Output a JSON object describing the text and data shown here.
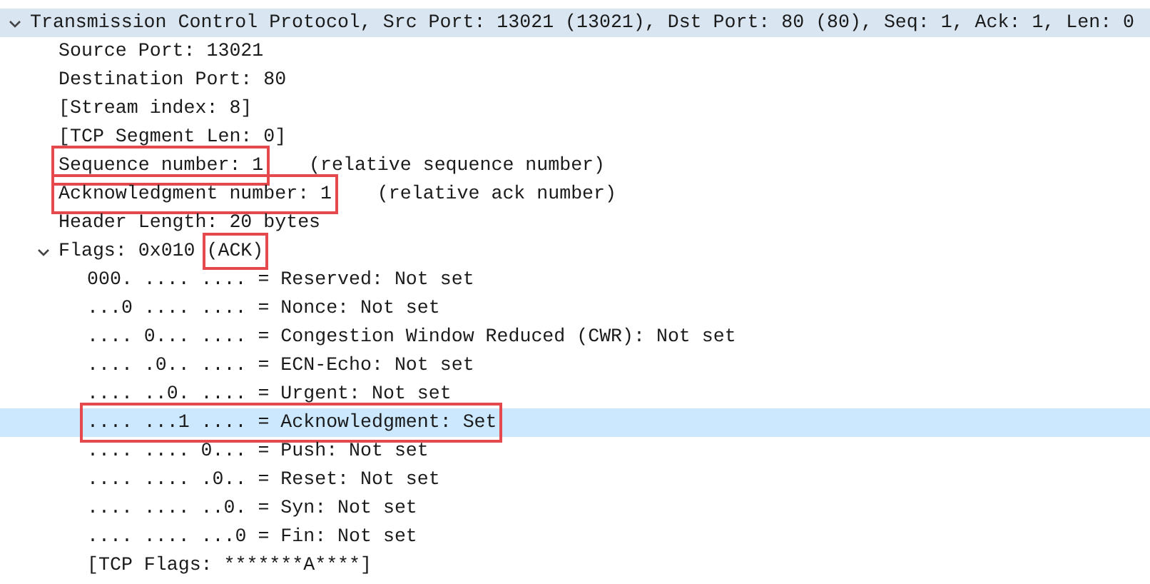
{
  "tree": [
    {
      "text": "Transmission Control Protocol, Src Port: 13021 (13021), Dst Port: 80 (80), Seq: 1, Ack: 1, Len: 0",
      "expanded": true,
      "selected": false,
      "shaded": true,
      "children": [
        {
          "text": "Source Port: 13021",
          "selected": false
        },
        {
          "text": "Destination Port: 80",
          "selected": false
        },
        {
          "text": "[Stream index: 8]",
          "selected": false
        },
        {
          "text": "[TCP Segment Len: 0]",
          "selected": false
        },
        {
          "text": "Sequence number: 1",
          "comment": "(relative sequence number)",
          "boxed": true,
          "selected": false
        },
        {
          "text": "Acknowledgment number: 1",
          "comment": "(relative ack number)",
          "boxed": true,
          "selected": false
        },
        {
          "text": "Header Length: 20 bytes",
          "selected": false
        },
        {
          "text": "Flags: 0x010",
          "tag": "(ACK)",
          "tag_boxed": true,
          "expanded": true,
          "selected": false,
          "children": [
            {
              "text": "000. .... .... = Reserved: Not set",
              "selected": false
            },
            {
              "text": "...0 .... .... = Nonce: Not set",
              "selected": false
            },
            {
              "text": ".... 0... .... = Congestion Window Reduced (CWR): Not set",
              "selected": false
            },
            {
              "text": ".... .0.. .... = ECN-Echo: Not set",
              "selected": false
            },
            {
              "text": ".... ..0. .... = Urgent: Not set",
              "selected": false
            },
            {
              "text": ".... ...1 .... = Acknowledgment: Set",
              "boxed": true,
              "selected": true
            },
            {
              "text": ".... .... 0... = Push: Not set",
              "selected": false
            },
            {
              "text": ".... .... .0.. = Reset: Not set",
              "selected": false
            },
            {
              "text": ".... .... ..0. = Syn: Not set",
              "selected": false
            },
            {
              "text": ".... .... ...0 = Fin: Not set",
              "selected": false
            },
            {
              "text": "[TCP Flags: *******A****]",
              "selected": false
            }
          ]
        }
      ]
    }
  ]
}
